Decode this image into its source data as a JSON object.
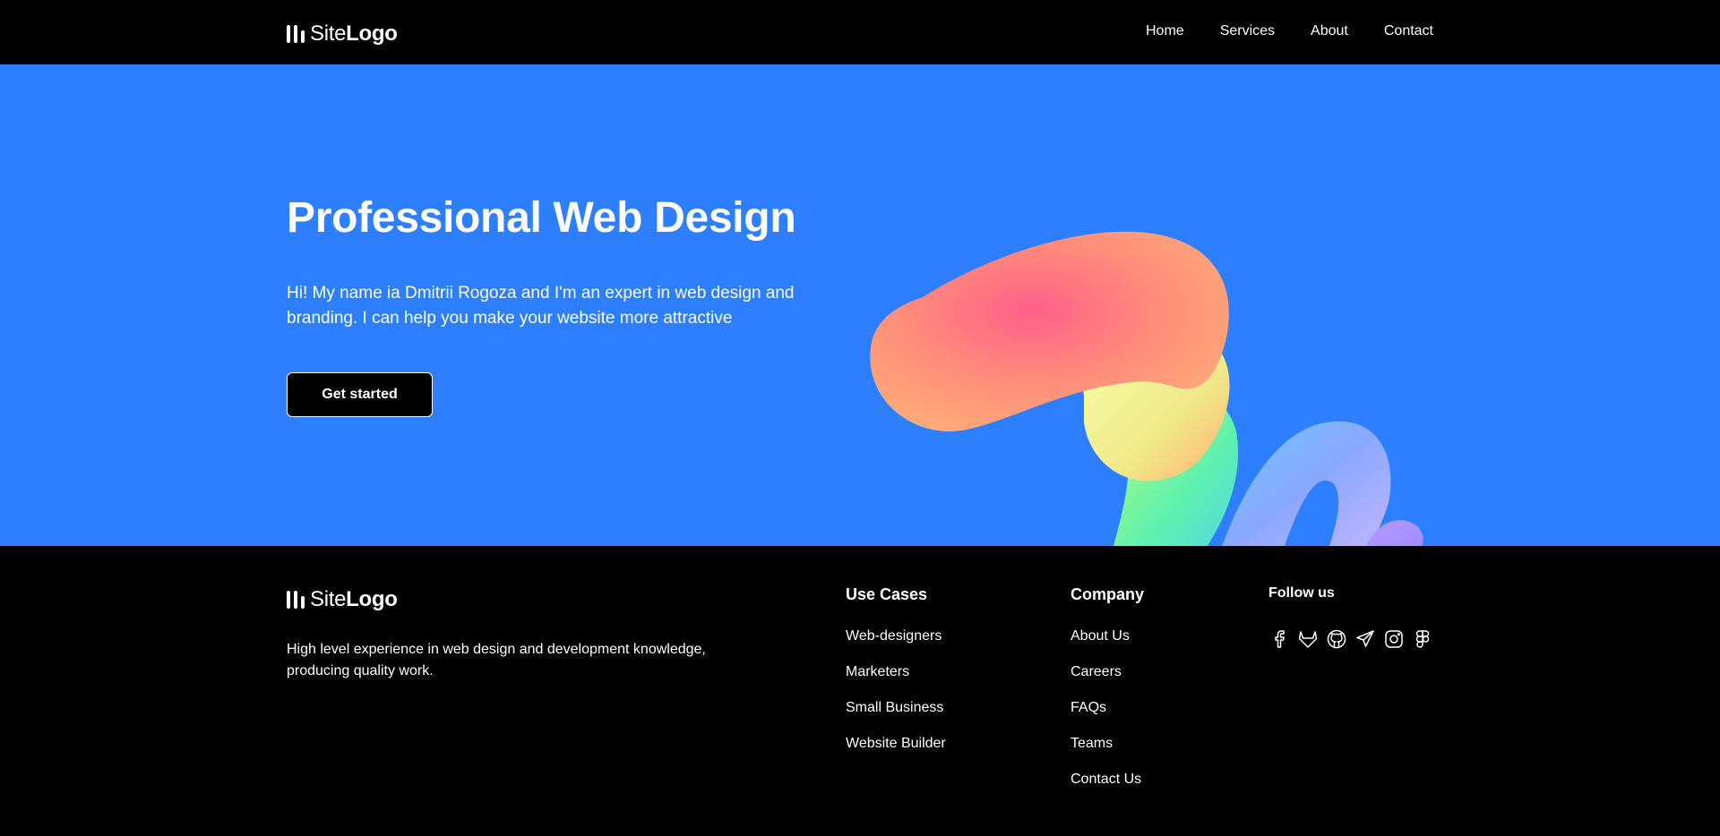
{
  "header": {
    "logo": {
      "thin": "Site",
      "bold": "Logo"
    },
    "nav": [
      {
        "label": "Home"
      },
      {
        "label": "Services"
      },
      {
        "label": "About"
      },
      {
        "label": "Contact"
      }
    ]
  },
  "hero": {
    "title": "Professional Web Design",
    "text": "Hi! My name ia Dmitrii Rogoza and I'm an expert in web design and branding. I can help you make your website more attractive",
    "cta": "Get started",
    "background": "#2d7fff"
  },
  "footer": {
    "logo": {
      "thin": "Site",
      "bold": "Logo"
    },
    "description": "High level experience in web design and development knowledge, producing quality work.",
    "use_cases": {
      "title": "Use Cases",
      "items": [
        "Web-designers",
        "Marketers",
        "Small Business",
        "Website Builder"
      ]
    },
    "company": {
      "title": "Company",
      "items": [
        "About Us",
        "Careers",
        "FAQs",
        "Teams",
        "Contact Us"
      ]
    },
    "follow": {
      "title": "Follow us",
      "icons": [
        "facebook-icon",
        "gitlab-icon",
        "github-icon",
        "telegram-icon",
        "instagram-icon",
        "figma-icon"
      ]
    }
  }
}
